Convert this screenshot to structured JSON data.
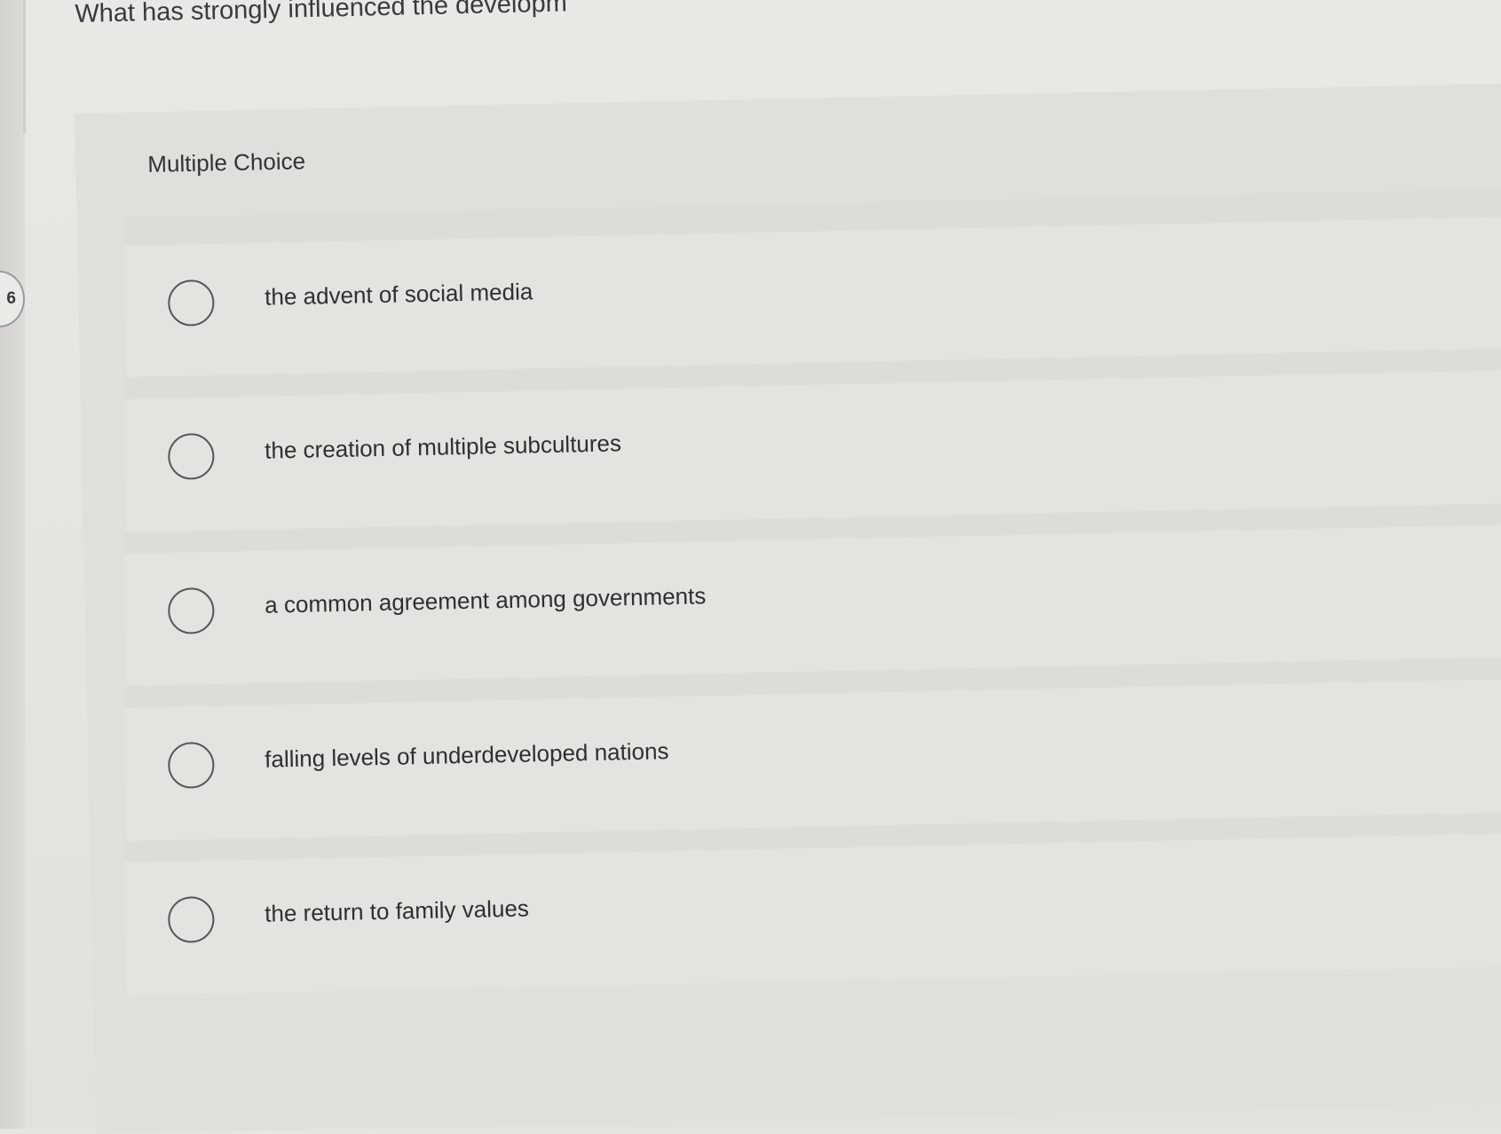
{
  "question": {
    "text": "What has strongly influenced the developm",
    "number_fragment": "6"
  },
  "mc": {
    "type_label": "Multiple Choice"
  },
  "options": [
    {
      "label": "the advent of social media",
      "selected": false
    },
    {
      "label": "the creation of multiple subcultures",
      "selected": false
    },
    {
      "label": "a common agreement among governments",
      "selected": false
    },
    {
      "label": "falling levels of underdeveloped nations",
      "selected": false
    },
    {
      "label": "the return to family values",
      "selected": false
    }
  ]
}
